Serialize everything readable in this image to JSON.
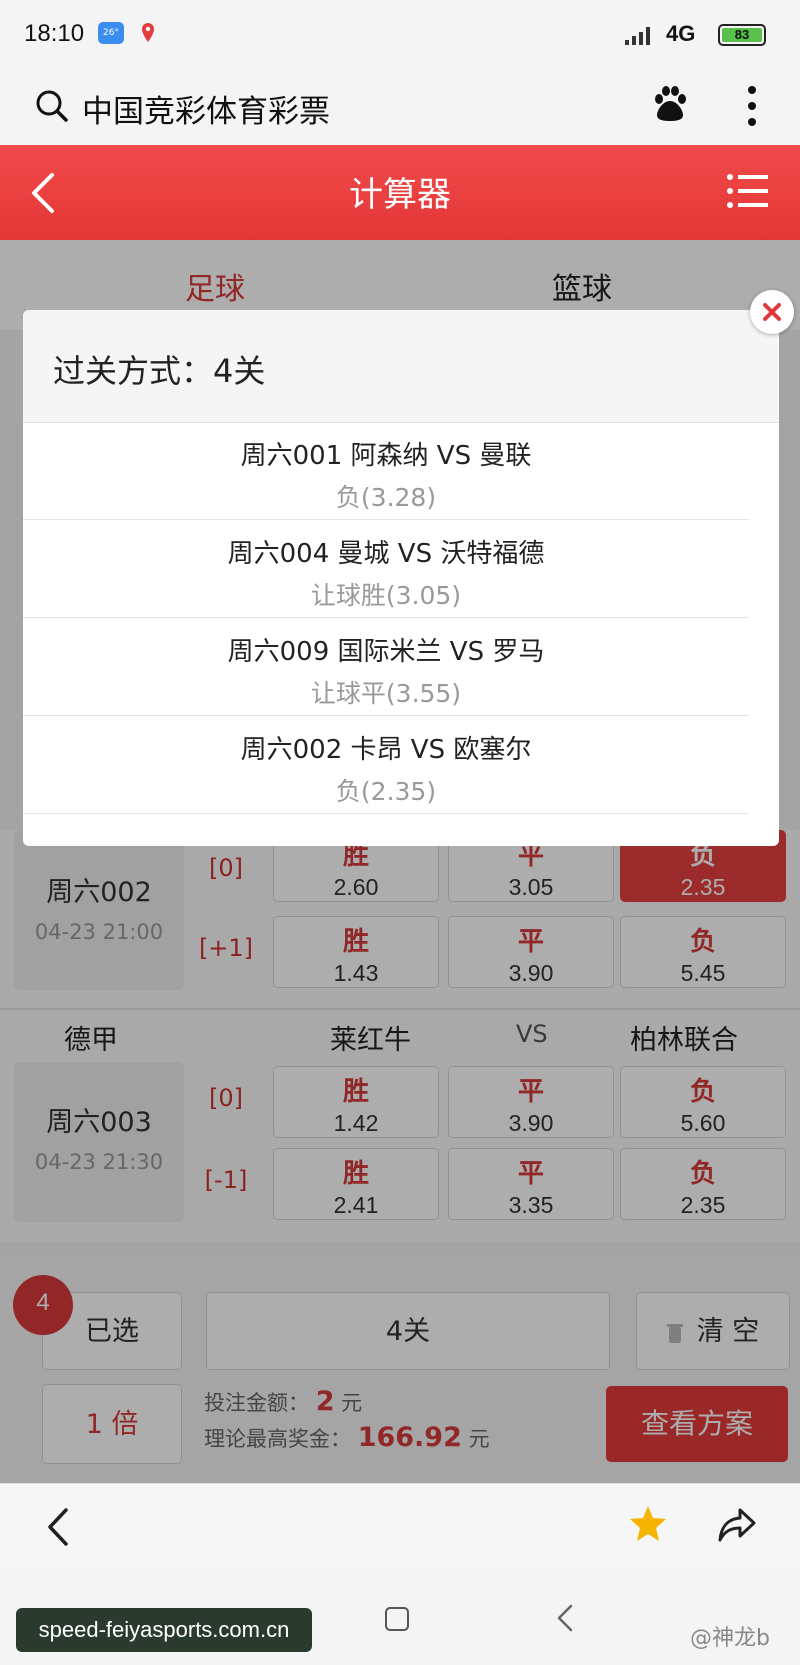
{
  "status_bar": {
    "time": "18:10",
    "weather_badge": "26°",
    "network": "4G",
    "battery": "83"
  },
  "browser": {
    "title": "中国竞彩体育彩票"
  },
  "header": {
    "title": "计算器"
  },
  "tabs": [
    {
      "label": "足球",
      "active": true
    },
    {
      "label": "篮球",
      "active": false
    }
  ],
  "matches": [
    {
      "code": "周六002",
      "time": "04-23 21:00",
      "rows": [
        {
          "handicap": "[0]",
          "odds": [
            {
              "label": "胜",
              "value": "2.60"
            },
            {
              "label": "平",
              "value": "3.05"
            },
            {
              "label": "负",
              "value": "2.35",
              "selected": true
            }
          ]
        },
        {
          "handicap": "[+1]",
          "odds": [
            {
              "label": "胜",
              "value": "1.43"
            },
            {
              "label": "平",
              "value": "3.90"
            },
            {
              "label": "负",
              "value": "5.45"
            }
          ]
        }
      ]
    },
    {
      "league": "德甲",
      "home": "莱红牛",
      "vs": "VS",
      "away": "柏林联合",
      "code": "周六003",
      "time": "04-23 21:30",
      "rows": [
        {
          "handicap": "[0]",
          "odds": [
            {
              "label": "胜",
              "value": "1.42"
            },
            {
              "label": "平",
              "value": "3.90"
            },
            {
              "label": "负",
              "value": "5.60"
            }
          ]
        },
        {
          "handicap": "[-1]",
          "odds": [
            {
              "label": "胜",
              "value": "2.41"
            },
            {
              "label": "平",
              "value": "3.35"
            },
            {
              "label": "负",
              "value": "2.35"
            }
          ]
        }
      ]
    }
  ],
  "bottom_panel": {
    "selected_count": "4",
    "selected_label": "已选",
    "pass_mode": "4关",
    "clear_label": "清 空",
    "multiplier": "1 倍",
    "amount_label": "投注金额：",
    "amount_value": "2",
    "amount_unit": "元",
    "max_prize_label": "理论最高奖金：",
    "max_prize_value": "166.92",
    "max_prize_unit": "元",
    "view_plan": "查看方案"
  },
  "modal": {
    "title": "过关方式：4关",
    "items": [
      {
        "match": "周六001 阿森纳 VS 曼联",
        "pick": "负(3.28)"
      },
      {
        "match": "周六004 曼城 VS 沃特福德",
        "pick": "让球胜(3.05)"
      },
      {
        "match": "周六009 国际米兰 VS 罗马",
        "pick": "让球平(3.55)"
      },
      {
        "match": "周六002 卡昂 VS 欧塞尔",
        "pick": "负(2.35)"
      }
    ]
  },
  "footer": {
    "watermark": "speed-feiyasports.com.cn",
    "credit": "@神龙b"
  },
  "colors": {
    "accent": "#e43b3b",
    "selected_odd": "#e64141",
    "star": "#f5b400"
  }
}
